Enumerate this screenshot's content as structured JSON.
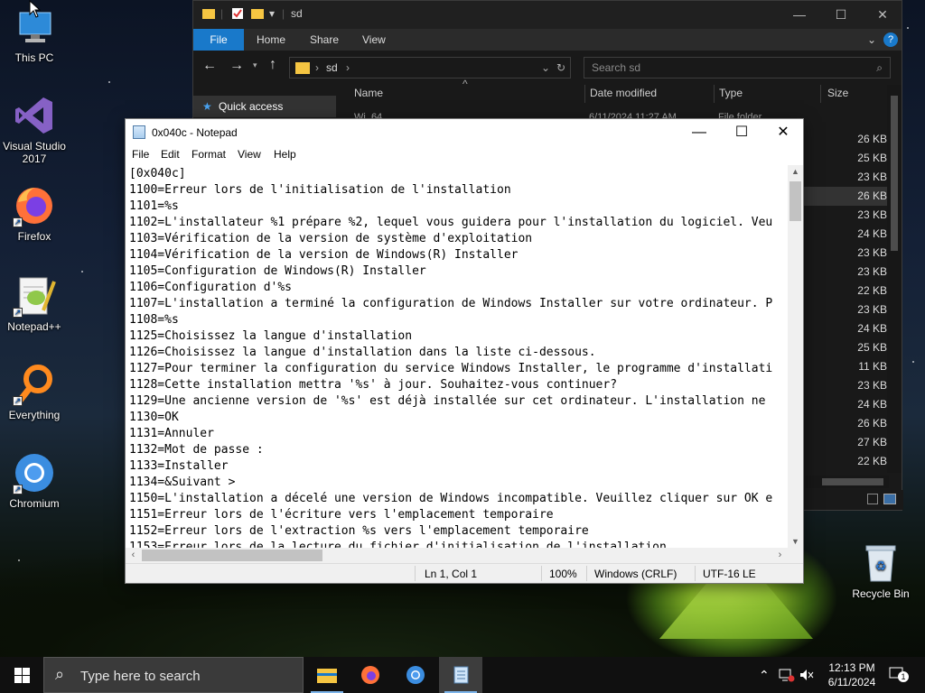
{
  "desktop": {
    "icons": [
      {
        "label": "This PC"
      },
      {
        "label": "Visual Studio 2017"
      },
      {
        "label": "Firefox"
      },
      {
        "label": "Notepad++"
      },
      {
        "label": "Everything"
      },
      {
        "label": "Chromium"
      },
      {
        "label": "Recycle Bin"
      }
    ]
  },
  "explorer": {
    "title": "sd",
    "tabs": [
      "File",
      "Home",
      "Share",
      "View"
    ],
    "address": "sd",
    "search_placeholder": "Search sd",
    "quick_access": "Quick access",
    "columns": [
      "Name",
      "Date modified",
      "Type",
      "Size"
    ],
    "partial_row": {
      "name": "Wi_64",
      "date": "6/11/2024 11:27 AM",
      "type": "File folder"
    },
    "sizes": [
      "26 KB",
      "25 KB",
      "23 KB",
      "26 KB",
      "23 KB",
      "24 KB",
      "23 KB",
      "23 KB",
      "22 KB",
      "23 KB",
      "24 KB",
      "25 KB",
      "11 KB",
      "23 KB",
      "24 KB",
      "26 KB",
      "27 KB",
      "22 KB"
    ]
  },
  "notepad": {
    "title": "0x040c - Notepad",
    "menu": [
      "File",
      "Edit",
      "Format",
      "View",
      "Help"
    ],
    "lines": [
      "[0x040c]",
      "1100=Erreur lors de l'initialisation de l'installation",
      "1101=%s",
      "1102=L'installateur %1 prépare %2, lequel vous guidera pour l'installation du logiciel. Veu",
      "1103=Vérification de la version de système d'exploitation",
      "1104=Vérification de la version de Windows(R) Installer",
      "1105=Configuration de Windows(R) Installer",
      "1106=Configuration d'%s",
      "1107=L'installation a terminé la configuration de Windows Installer sur votre ordinateur. P",
      "1108=%s",
      "1125=Choisissez la langue d'installation",
      "1126=Choisissez la langue d'installation dans la liste ci-dessous.",
      "1127=Pour terminer la configuration du service Windows Installer, le programme d'installati",
      "1128=Cette installation mettra '%s' à jour. Souhaitez-vous continuer?",
      "1129=Une ancienne version de '%s' est déjà installée sur cet ordinateur. L'installation ne",
      "1130=OK",
      "1131=Annuler",
      "1132=Mot de passe :",
      "1133=Installer",
      "1134=&Suivant >",
      "1150=L'installation a décelé une version de Windows incompatible. Veuillez cliquer sur OK e",
      "1151=Erreur lors de l'écriture vers l'emplacement temporaire",
      "1152=Erreur lors de l'extraction %s vers l'emplacement temporaire",
      "1153=Erreur lors de la lecture du fichier d'initialisation de l'installation"
    ],
    "status": {
      "position": "Ln 1, Col 1",
      "zoom": "100%",
      "line_ending": "Windows (CRLF)",
      "encoding": "UTF-16 LE"
    }
  },
  "taskbar": {
    "search_placeholder": "Type here to search",
    "apps": [
      "File Explorer",
      "Firefox",
      "Chromium",
      "Notepad"
    ],
    "time": "12:13 PM",
    "date": "6/11/2024",
    "notification_count": "1"
  },
  "colors": {
    "accent": "#1979ca",
    "explorer_bg": "#191919",
    "taskbar_bg": "#101010"
  }
}
